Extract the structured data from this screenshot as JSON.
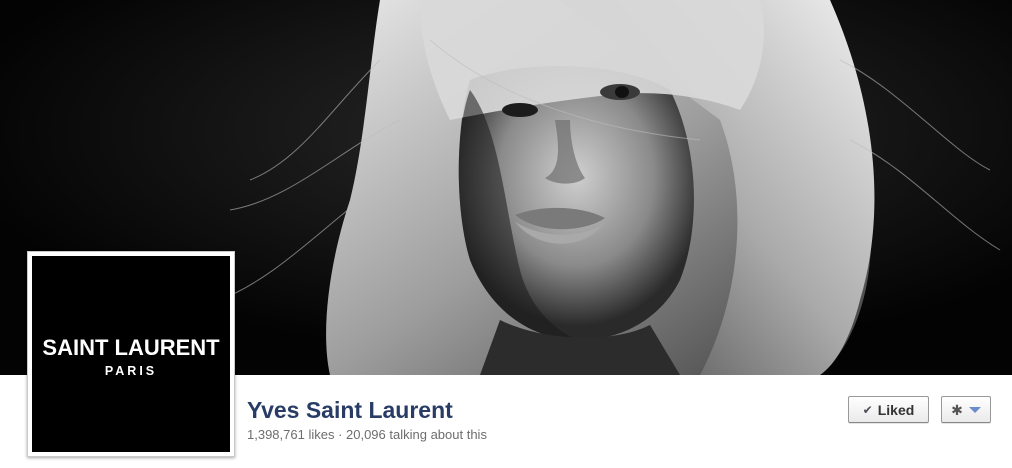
{
  "cover": {
    "description_icon": "cover-photo"
  },
  "profile": {
    "logo_line1": "SAINT LAURENT",
    "logo_line2": "PARIS"
  },
  "page": {
    "name": "Yves Saint Laurent",
    "stats": "1,398,761 likes · 20,096 talking about this"
  },
  "actions": {
    "liked_label": "Liked",
    "liked_icon": "check-icon",
    "settings_icon": "gear-icon",
    "settings_caret": "chevron-down-icon"
  },
  "colors": {
    "page_name": "#283c66",
    "stats_text": "#6d6d6d",
    "caret": "#6a8ccf"
  }
}
